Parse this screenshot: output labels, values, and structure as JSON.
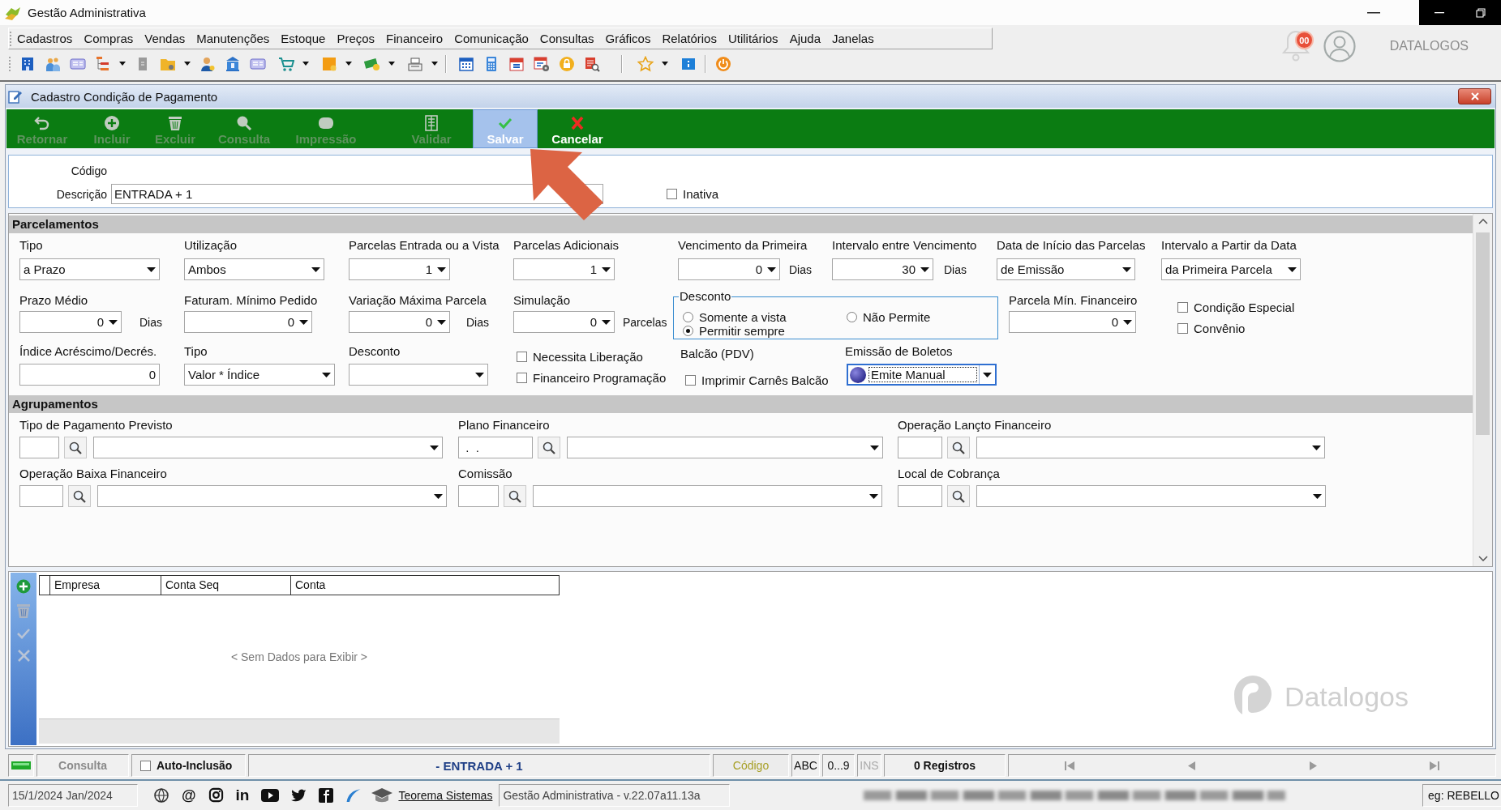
{
  "window": {
    "title": "Gestão Administrativa"
  },
  "menu": [
    "Cadastros",
    "Compras",
    "Vendas",
    "Manutenções",
    "Estoque",
    "Preços",
    "Financeiro",
    "Comunicação",
    "Consultas",
    "Gráficos",
    "Relatórios",
    "Utilitários",
    "Ajuda",
    "Janelas"
  ],
  "topbar": {
    "notifications": "00",
    "account": "DATALOGOS"
  },
  "form": {
    "title": "Cadastro Condição de Pagamento",
    "actions": [
      {
        "label": "Retornar",
        "disabled": true,
        "highlighted": false
      },
      {
        "label": "Incluir",
        "disabled": true,
        "highlighted": false
      },
      {
        "label": "Excluir",
        "disabled": true,
        "highlighted": false
      },
      {
        "label": "Consulta",
        "disabled": true,
        "highlighted": false
      },
      {
        "label": "Impressão",
        "disabled": true,
        "highlighted": false
      },
      {
        "label": "Validar",
        "disabled": true,
        "highlighted": false
      },
      {
        "label": "Salvar",
        "disabled": false,
        "highlighted": true
      },
      {
        "label": "Cancelar",
        "disabled": false,
        "highlighted": false
      }
    ],
    "codigo": {
      "label": "Código"
    },
    "descricao": {
      "label": "Descrição",
      "value": "ENTRADA + 1"
    },
    "inativa": {
      "label": "Inativa",
      "checked": false
    }
  },
  "parcelamentos": {
    "title": "Parcelamentos",
    "tipo": {
      "label": "Tipo",
      "value": "a Prazo"
    },
    "utilizacao": {
      "label": "Utilização",
      "value": "Ambos"
    },
    "parcelas_entrada": {
      "label": "Parcelas Entrada ou a Vista",
      "value": "1"
    },
    "parcelas_adicionais": {
      "label": "Parcelas Adicionais",
      "value": "1"
    },
    "vencimento_primeira": {
      "label": "Vencimento da Primeira",
      "value": "0",
      "unit": "Dias"
    },
    "intervalo_vencimento": {
      "label": "Intervalo entre Vencimento",
      "value": "30",
      "unit": "Dias"
    },
    "data_inicio": {
      "label": "Data de Início das Parcelas",
      "value": "de Emissão"
    },
    "intervalo_partir": {
      "label": "Intervalo a Partir da Data",
      "value": "da Primeira Parcela"
    },
    "prazo_medio": {
      "label": "Prazo Médio",
      "value": "0",
      "unit": "Dias"
    },
    "faturamento_minimo": {
      "label": "Faturam. Mínimo Pedido",
      "value": "0"
    },
    "variacao_maxima": {
      "label": "Variação Máxima Parcela",
      "value": "0",
      "unit": "Dias"
    },
    "simulacao": {
      "label": "Simulação",
      "value": "0",
      "unit": "Parcelas"
    },
    "desconto_group": {
      "title": "Desconto",
      "options": [
        {
          "label": "Somente a vista",
          "selected": false
        },
        {
          "label": "Permitir sempre",
          "selected": true
        },
        {
          "label": "Não Permite",
          "selected": false
        }
      ]
    },
    "parcela_min": {
      "label": "Parcela Mín. Financeiro",
      "value": "0"
    },
    "flags": [
      {
        "label": "Condição Especial",
        "checked": false
      },
      {
        "label": "Convênio",
        "checked": false
      }
    ],
    "indice": {
      "label": "Índice Acréscimo/Decrés.",
      "value": "0"
    },
    "tipo_indice": {
      "label": "Tipo",
      "value": "Valor * Índice"
    },
    "desconto": {
      "label": "Desconto"
    },
    "options": [
      {
        "label": "Necessita Liberação",
        "checked": false
      },
      {
        "label": "Financeiro Programação",
        "checked": false
      }
    ],
    "balcao": {
      "title": "Balcão (PDV)",
      "option": {
        "label": "Imprimir Carnês Balcão",
        "checked": false
      }
    },
    "emissao_boletos": {
      "label": "Emissão de Boletos",
      "value": "Emite Manual",
      "focused": true
    }
  },
  "agrupamentos": {
    "title": "Agrupamentos",
    "lookups": [
      {
        "label": "Tipo de Pagamento Previsto"
      },
      {
        "label": "Plano Financeiro",
        "code": " .  ."
      },
      {
        "label": "Operação Lançto Financeiro"
      },
      {
        "label": "Operação Baixa Financeiro"
      },
      {
        "label": "Comissão"
      },
      {
        "label": "Local de Cobrança"
      }
    ]
  },
  "grid": {
    "columns": [
      "Empresa",
      "Conta Seq",
      "Conta"
    ],
    "empty_message": "< Sem Dados para Exibir >",
    "watermark": "Datalogos"
  },
  "status_bar": {
    "mode": "Consulta",
    "auto_inclusao": {
      "label": "Auto-Inclusão",
      "checked": false
    },
    "record": "- ENTRADA + 1",
    "search_field": "Código",
    "keys": [
      {
        "label": "ABC",
        "disabled": false
      },
      {
        "label": "0...9",
        "disabled": false
      },
      {
        "label": "INS",
        "disabled": true
      }
    ],
    "count": "0 Registros"
  },
  "footer": {
    "date": "15/1/2024 Jan/2024",
    "at_sign": "@",
    "in_mark": "in",
    "link": "Teorema Sistemas",
    "version": "Gestão Administrativa - v.22.07a11.13a",
    "user": "eg: REBELLO"
  }
}
